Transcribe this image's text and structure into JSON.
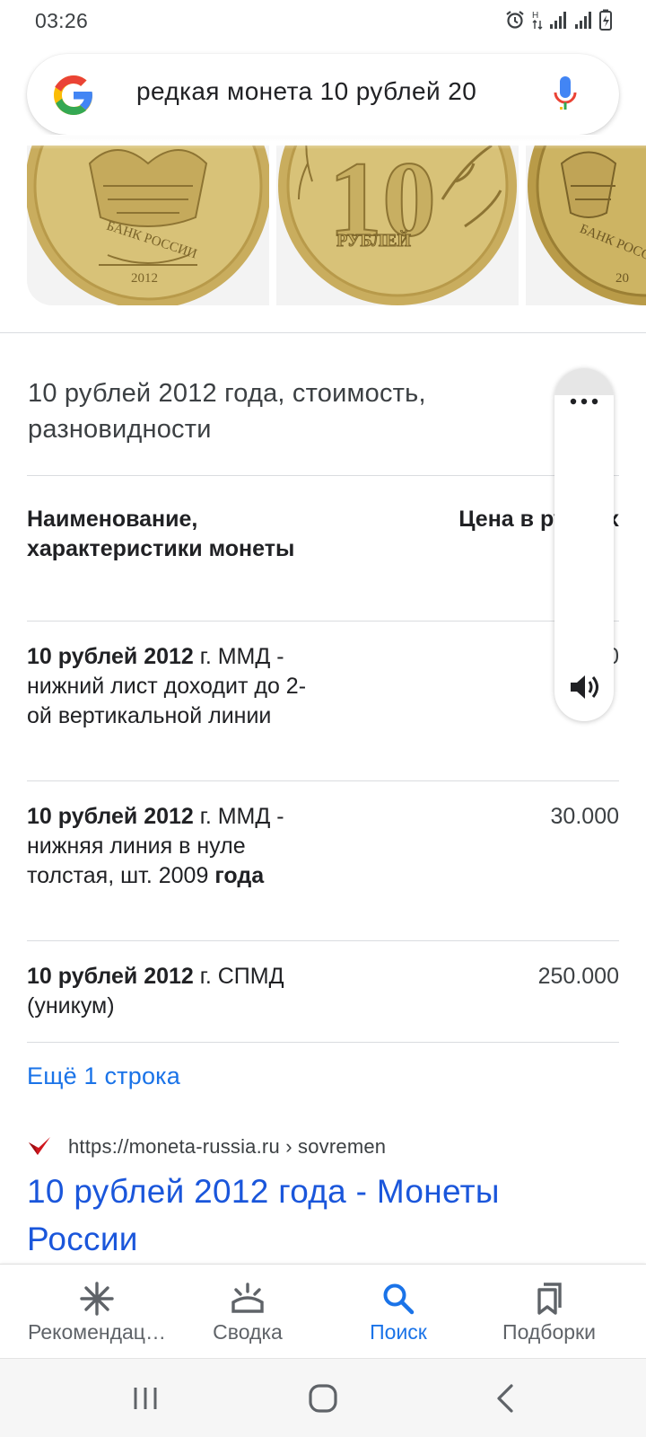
{
  "status_bar": {
    "time": "03:26",
    "icons": [
      "alarm-icon",
      "data-arrows-icon",
      "signal-icon",
      "signal-icon",
      "battery-icon"
    ]
  },
  "search": {
    "query": "редкая монета 10 рублей 20",
    "logo": "google-g-logo",
    "voice_icon": "mic-icon"
  },
  "images": [
    {
      "description": "coin-obverse-eagle",
      "legend": "БАНК РОССИИ",
      "year": "2012"
    },
    {
      "description": "coin-reverse-10",
      "denomination": "10",
      "legend": "РУБЛЕЙ"
    },
    {
      "description": "coin-obverse-eagle-partial",
      "legend": "БАНК РОССИИ",
      "year": "20"
    }
  ],
  "snippet": {
    "title": "10 рублей 2012 года, стоимость, разновидности",
    "table": {
      "header_name": "Наименование, характеристики монеты",
      "header_price": "Цена в рублях",
      "rows": [
        {
          "name_bold": "10 рублей 2012",
          "name_rest": "г. ММД - нижний лист доходит до 2-ой вертикальной линии",
          "name_tail_bold": "",
          "price": "0"
        },
        {
          "name_bold": "10 рублей 2012",
          "name_rest": "г. ММД - нижняя линия в нуле толстая, шт. 2009",
          "name_tail_bold": "года",
          "price": "30.000"
        },
        {
          "name_bold": "10 рублей 2012",
          "name_rest": "г. СПМД (уникум)",
          "name_tail_bold": "",
          "price": "250.000"
        }
      ]
    },
    "more_rows": "Ещё 1 строка"
  },
  "result": {
    "url": "https://moneta-russia.ru › sovremen",
    "title": "10 рублей 2012 года - Монеты России",
    "favicon": "checkmark-favicon"
  },
  "floating_panel": {
    "icons": [
      "more-horizontal-icon",
      "speaker-icon"
    ]
  },
  "bottom_nav": {
    "items": [
      {
        "label": "Рекомендац…",
        "icon": "asterisk-icon",
        "active": false
      },
      {
        "label": "Сводка",
        "icon": "sunrise-icon",
        "active": false
      },
      {
        "label": "Поиск",
        "icon": "search-icon",
        "active": true
      },
      {
        "label": "Подборки",
        "icon": "bookmarks-icon",
        "active": false
      }
    ]
  },
  "system_nav": {
    "buttons": [
      "recents-icon",
      "home-icon",
      "back-icon"
    ]
  },
  "colors": {
    "link_blue": "#1a73e8",
    "title_blue": "#1a56db",
    "text": "#202124",
    "secondary_text": "#3c4043",
    "divider": "#dadce0",
    "coin_gold": "#cdb463"
  }
}
